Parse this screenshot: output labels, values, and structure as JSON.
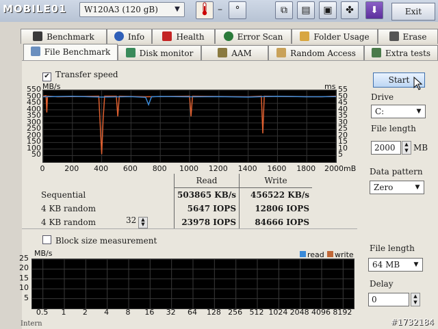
{
  "header": {
    "logo": "MOBILE01",
    "device": "W120A3    (120 gB)",
    "temperature": "–",
    "exit_label": "Exit"
  },
  "tabs_back": [
    {
      "label": "Benchmark",
      "icon": "benchmark-icon"
    },
    {
      "label": "Info",
      "icon": "info-icon"
    },
    {
      "label": "Health",
      "icon": "health-cross-icon"
    },
    {
      "label": "Error Scan",
      "icon": "magnifier-icon"
    },
    {
      "label": "Folder Usage",
      "icon": "folder-icon"
    },
    {
      "label": "Erase",
      "icon": "trash-icon"
    }
  ],
  "tabs_front": [
    {
      "label": "File Benchmark",
      "icon": "file-benchmark-icon",
      "active": true
    },
    {
      "label": "Disk monitor",
      "icon": "disk-monitor-icon"
    },
    {
      "label": "AAM",
      "icon": "speaker-icon"
    },
    {
      "label": "Random Access",
      "icon": "random-access-icon"
    },
    {
      "label": "Extra tests",
      "icon": "extra-tests-icon"
    }
  ],
  "transfer": {
    "checkbox_label": "Transfer speed",
    "checked": true,
    "left_unit": "MB/s",
    "right_unit": "ms"
  },
  "chart_data": [
    {
      "type": "line",
      "title": "",
      "xlabel": "",
      "x_unit": "mB",
      "ylabel_left": "MB/s",
      "ylabel_right": "ms",
      "xlim": [
        0,
        2000
      ],
      "ylim": [
        0,
        550
      ],
      "x_ticks": [
        "0",
        "200",
        "400",
        "600",
        "800",
        "1000",
        "1200",
        "1400",
        "1600",
        "1800",
        "2000mB"
      ],
      "y_ticks_left": [
        "550",
        "500",
        "450",
        "400",
        "350",
        "300",
        "250",
        "200",
        "150",
        "100",
        "50"
      ],
      "y_ticks_right": [
        "55",
        "50",
        "45",
        "40",
        "35",
        "30",
        "25",
        "20",
        "15",
        "10",
        "5"
      ],
      "grid": true,
      "series": [
        {
          "values_x": [
            0,
            20,
            25,
            30,
            100,
            380,
            400,
            410,
            420,
            500,
            510,
            520,
            700,
            1000,
            1010,
            1020,
            1400,
            1490,
            1500,
            1510,
            1900,
            1990,
            2000
          ],
          "values_y": [
            505,
            508,
            380,
            505,
            500,
            505,
            60,
            330,
            505,
            505,
            350,
            505,
            500,
            505,
            350,
            505,
            500,
            505,
            220,
            505,
            500,
            505,
            505
          ],
          "color": "#e06030"
        },
        {
          "values_x": [
            0,
            200,
            400,
            600,
            700,
            720,
            740,
            800,
            1000,
            1200,
            1400,
            1600,
            1800,
            2000
          ],
          "values_y": [
            500,
            504,
            498,
            502,
            496,
            440,
            500,
            503,
            500,
            502,
            498,
            504,
            500,
            502
          ],
          "color": "#3a8ad8"
        }
      ]
    },
    {
      "type": "bar",
      "title": "",
      "ylabel": "MB/s",
      "ylim": [
        0,
        25
      ],
      "y_ticks": [
        "25",
        "20",
        "15",
        "10",
        "5"
      ],
      "categories": [
        "0.5",
        "1",
        "2",
        "4",
        "8",
        "16",
        "32",
        "64",
        "128",
        "256",
        "512",
        "1024",
        "2048",
        "4096",
        "8192"
      ],
      "series": [
        {
          "name": "read",
          "color": "#3a8ad8",
          "values": []
        },
        {
          "name": "write",
          "color": "#c06838",
          "values": []
        }
      ]
    }
  ],
  "results": {
    "col_read": "Read",
    "col_write": "Write",
    "rows": [
      {
        "label": "Sequential",
        "read": "503865 KB/s",
        "write": "456522 KB/s"
      },
      {
        "label": "4 KB random",
        "read": "5647 IOPS",
        "write": "12806 IOPS"
      },
      {
        "label": "4 KB random",
        "queue_depth": "32",
        "read": "23978 IOPS",
        "write": "84666 IOPS"
      }
    ]
  },
  "controls": {
    "start_label": "Start",
    "drive_label": "Drive",
    "drive_value": "C:",
    "file_length_label": "File length",
    "file_length_value": "2000",
    "file_length_unit": "MB",
    "data_pattern_label": "Data pattern",
    "data_pattern_value": "Zero"
  },
  "block": {
    "checkbox_label": "Block size measurement",
    "checked": false,
    "unit": "MB/s",
    "legend_read": "read",
    "legend_write": "write",
    "file_length_label": "File length",
    "file_length_value": "64 MB",
    "delay_label": "Delay",
    "delay_value": "0"
  },
  "watermark": "#1732184",
  "status_text": "Intern"
}
